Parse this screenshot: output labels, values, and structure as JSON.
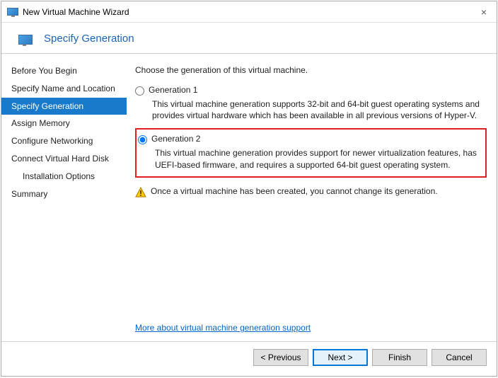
{
  "window": {
    "title": "New Virtual Machine Wizard",
    "close": "×"
  },
  "header": {
    "title": "Specify Generation"
  },
  "sidebar": {
    "items": [
      {
        "label": "Before You Begin"
      },
      {
        "label": "Specify Name and Location"
      },
      {
        "label": "Specify Generation"
      },
      {
        "label": "Assign Memory"
      },
      {
        "label": "Configure Networking"
      },
      {
        "label": "Connect Virtual Hard Disk"
      },
      {
        "label": "Installation Options"
      },
      {
        "label": "Summary"
      }
    ]
  },
  "main": {
    "instruction": "Choose the generation of this virtual machine.",
    "gen1": {
      "label": "Generation 1",
      "desc": "This virtual machine generation supports 32-bit and 64-bit guest operating systems and provides virtual hardware which has been available in all previous versions of Hyper-V."
    },
    "gen2": {
      "label": "Generation 2",
      "desc": "This virtual machine generation provides support for newer virtualization features, has UEFI-based firmware, and requires a supported 64-bit guest operating system."
    },
    "warning": "Once a virtual machine has been created, you cannot change its generation.",
    "link": "More about virtual machine generation support"
  },
  "buttons": {
    "previous": "< Previous",
    "next": "Next >",
    "finish": "Finish",
    "cancel": "Cancel"
  }
}
